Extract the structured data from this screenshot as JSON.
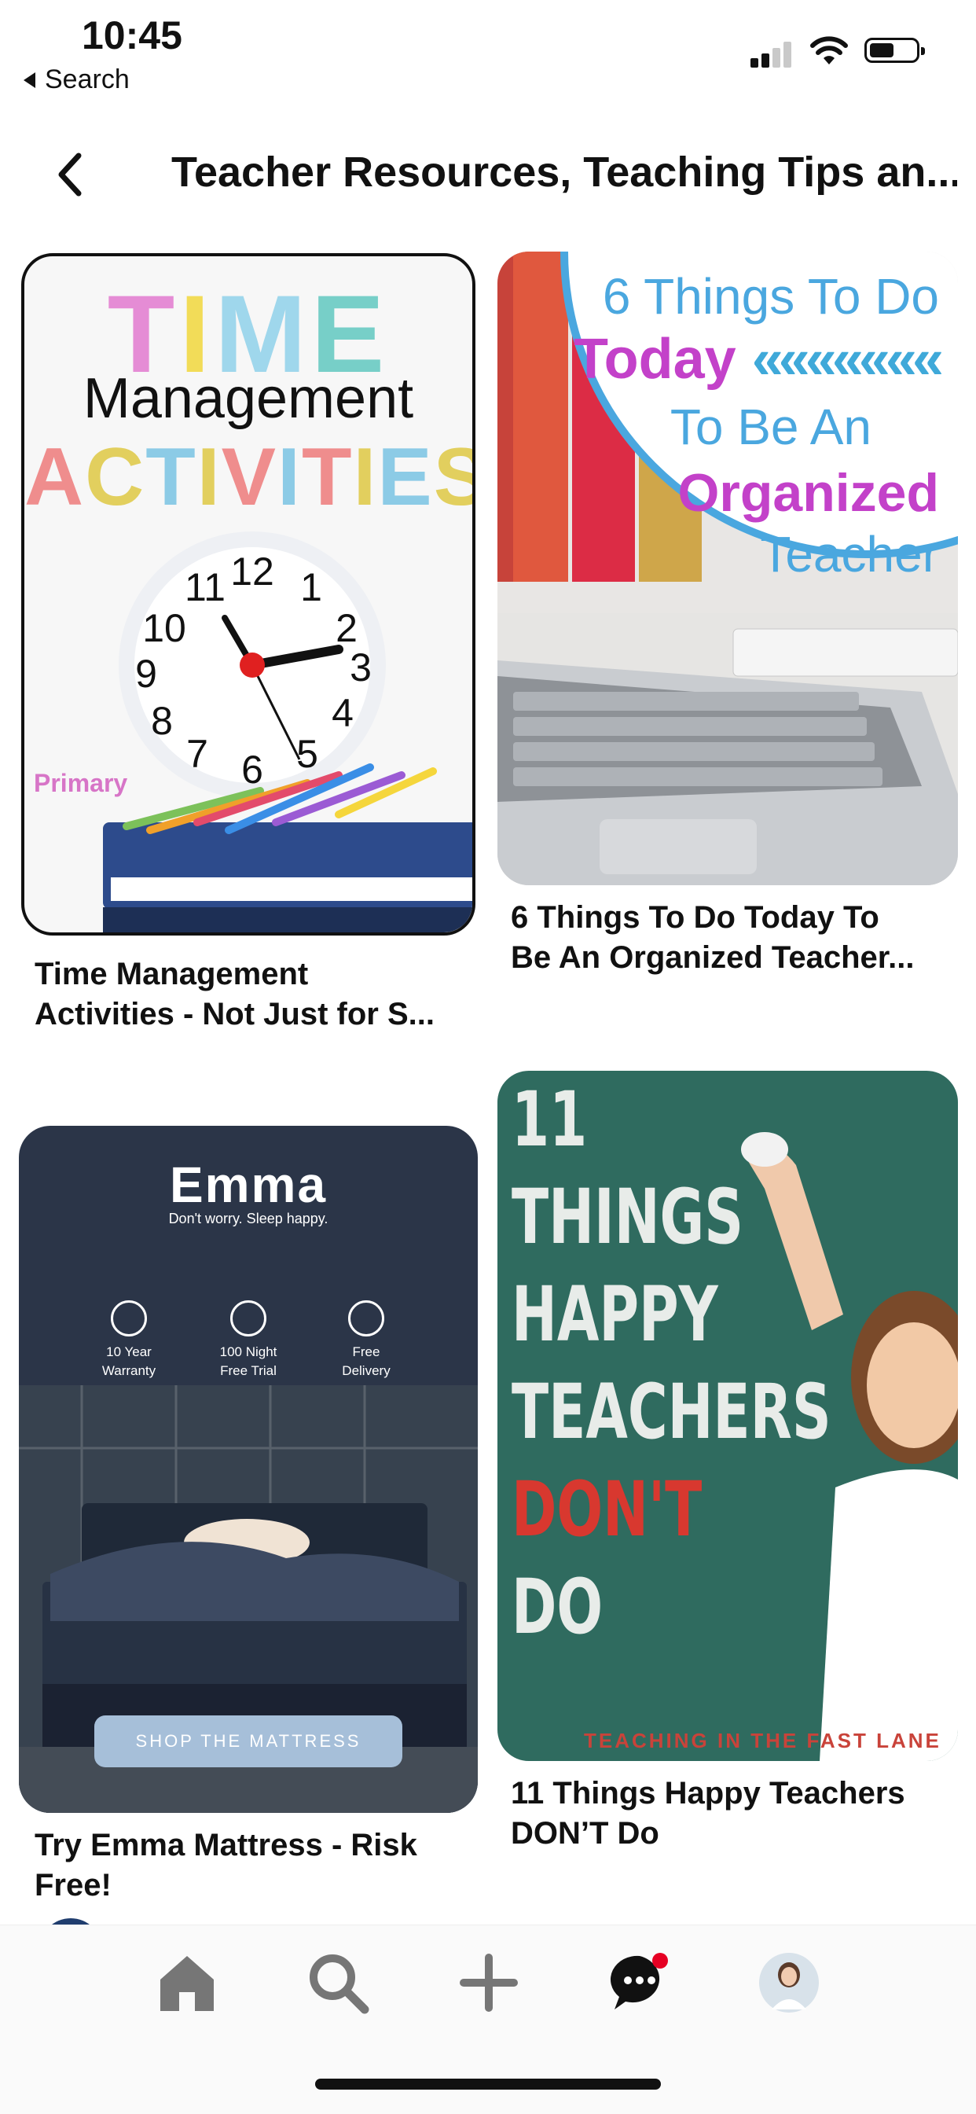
{
  "status_bar": {
    "time": "10:45",
    "back_app": "Search"
  },
  "header": {
    "title": "Teacher Resources, Teaching Tips an..."
  },
  "pins": [
    {
      "image_text": {
        "line1": "TIME",
        "line2": "Management",
        "line3": "ACTIVITIES",
        "brand": "Primary"
      },
      "title_lines": [
        "Time Management",
        "Activities - Not Just for S..."
      ]
    },
    {
      "image_text": {
        "line1": "6 Things To Do",
        "line2": "Today",
        "line3": "To Be An",
        "line4": "Organized",
        "line5": "Teacher"
      },
      "title_lines": [
        "6 Things To Do Today To",
        "Be An Organized Teacher..."
      ]
    },
    {
      "image_text": {
        "logo": "Emma",
        "tagline": "Don't worry. Sleep happy.",
        "features": [
          [
            "10 Year",
            "Warranty"
          ],
          [
            "100 Night",
            "Free Trial"
          ],
          [
            "Free",
            "Delivery"
          ]
        ],
        "cta": "SHOP THE MATTRESS"
      },
      "title_lines": [
        "Try Emma Mattress - Risk",
        "Free!"
      ]
    },
    {
      "image_text": {
        "lines": [
          "11",
          "THINGS",
          "HAPPY",
          "TEACHERS",
          "DON'T",
          "DO"
        ],
        "brand": "TEACHING IN THE FAST LANE"
      },
      "title_lines": [
        "11 Things Happy Teachers",
        "DON’T Do"
      ]
    }
  ],
  "bottom_nav": {
    "items": [
      "home-icon",
      "search-icon",
      "plus-icon",
      "messages-icon",
      "profile-avatar"
    ],
    "notification_color": "#e60023"
  }
}
